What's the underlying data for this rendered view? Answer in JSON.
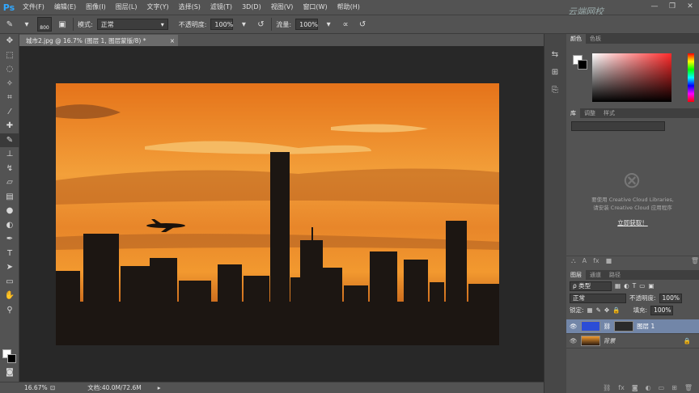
{
  "app": {
    "logo": "Ps",
    "watermark": "云端网校"
  },
  "menu": [
    "文件(F)",
    "编辑(E)",
    "图像(I)",
    "图层(L)",
    "文字(Y)",
    "选择(S)",
    "滤镜(T)",
    "3D(D)",
    "视图(V)",
    "窗口(W)",
    "帮助(H)"
  ],
  "options": {
    "brush_size": "800",
    "mode_label": "模式:",
    "mode_value": "正常",
    "opacity_label": "不透明度:",
    "opacity_value": "100%",
    "flow_label": "流量:",
    "flow_value": "100%"
  },
  "document": {
    "tab_title": "城市2.jpg @ 16.7% (图层 1, 图层蒙版/8) *",
    "close": "×"
  },
  "status": {
    "zoom": "16.67%",
    "doc_info": "文档:40.0M/72.6M"
  },
  "panels": {
    "color_tabs": [
      "颜色",
      "色板"
    ],
    "library_tabs": [
      "库",
      "调整",
      "样式"
    ],
    "library_message_1": "要使用 Creative Cloud Libraries,",
    "library_message_2": "请安装 Creative Cloud 应用程序",
    "library_link": "立即获取！",
    "layers_tabs": [
      "图层",
      "通道",
      "路径"
    ],
    "filter_kind": "ρ 类型",
    "blend_mode": "正常",
    "opacity_label": "不透明度:",
    "opacity_value": "100%",
    "lock_label": "锁定:",
    "fill_label": "填充:",
    "fill_value": "100%",
    "layers": [
      {
        "name": "图层 1"
      },
      {
        "name": "背景"
      }
    ]
  },
  "colors": {
    "accent": "#31a8ff",
    "selected_layer": "#7286a8"
  }
}
